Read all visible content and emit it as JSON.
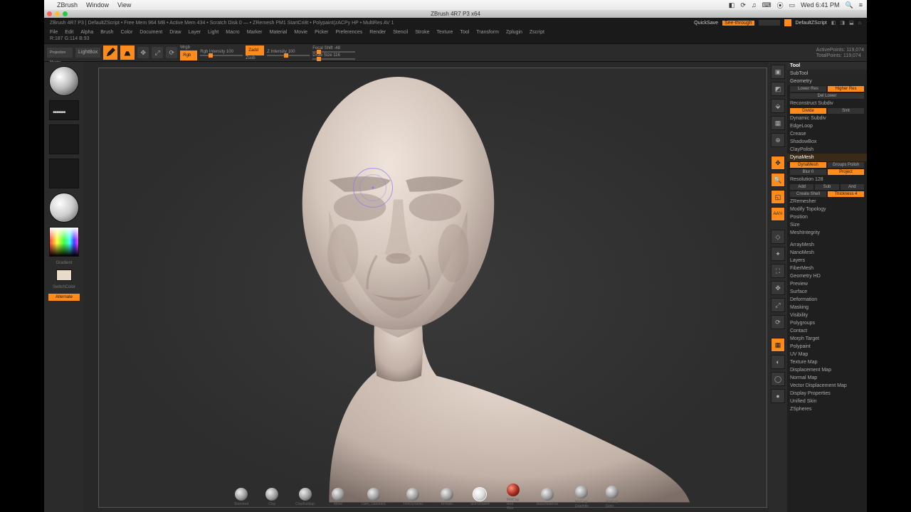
{
  "mac": {
    "app": "ZBrush",
    "menus": [
      "Window",
      "View"
    ],
    "clock": "Wed 6:41 PM"
  },
  "window": {
    "title": "ZBrush 4R7 P3 x64"
  },
  "topbar": {
    "project_info": "ZBrush 4R7 P3 | DefaultZScript  •  Free Mem 964 MB • Active Mem 434 • Scratch Disk 0  — • ZRemesh PM1 StartCri8t • Polypaint(zACPy HP • MultiRes AV 1",
    "quicksave": "QuickSave",
    "seethrough": "See-through",
    "script": "DefaultZScript"
  },
  "menu": [
    "File",
    "Edit",
    "Alpha",
    "Brush",
    "Color",
    "Document",
    "Draw",
    "Layer",
    "Light",
    "Macro",
    "Marker",
    "Material",
    "Movie",
    "Picker",
    "Preferences",
    "Render",
    "Stencil",
    "Stroke",
    "Texture",
    "Tool",
    "Transform",
    "Zplugin",
    "Zscript"
  ],
  "info_row": "R:187  G:114  B:93",
  "toolbar": {
    "projection": "Projection Master",
    "lightbox": "LightBox",
    "mrgb": "Mrgb",
    "rgb": "Rgb",
    "rgb_int": "Rgb Intensity 100",
    "zadd": "Zadd",
    "zsub": "Zsub",
    "z_int": "Z Intensity 100",
    "focal": "Focal Shift -48",
    "draw": "Draw Size 116",
    "active": "ActivePoints: 119,074",
    "total": "TotalPoints: 119,074"
  },
  "left": {
    "gradient": "Gradient",
    "switchcolor": "SwitchColor",
    "alternate": "Alternate"
  },
  "shelf": [
    "Standard",
    "Clay",
    "ClayBuildup",
    "Move",
    "Dam_Standard",
    "TrimDynamic",
    "hPolish",
    "SkinShade4",
    "MatCap Red Wax",
    "BasicMaterial",
    "MatCap Graphite",
    "MatCap Grey"
  ],
  "right_panel": {
    "tool": "Tool",
    "subtool": "SubTool",
    "geometry": "Geometry",
    "higher_res": "Higher Res",
    "lower_res": "Lower Res",
    "reconstruct": "Reconstruct Subdiv",
    "divide": "Divide",
    "del_lower": "Del Lower",
    "dynsmooth": "Smt",
    "edgeloop": "EdgeLoop",
    "crease": "Crease",
    "shadowbox": "ShadowBox",
    "claypolish": "ClayPolish",
    "dynamesh": "DynaMesh",
    "dyna_on": "DynaMesh",
    "groups_polish": "Groups Polish",
    "blur": "Blur 0",
    "project": "Project",
    "resolution": "Resolution 128",
    "add": "Add",
    "sub": "Sub",
    "and": "And",
    "create_shell": "Create Shell",
    "thickness": "Thickness 4",
    "zremesher": "ZRemesher",
    "modify_topo": "Modify Topology",
    "position": "Position",
    "size": "Size",
    "meshintegrity": "MeshIntegrity",
    "sections": [
      "ArrayMesh",
      "NanoMesh",
      "Layers",
      "FiberMesh",
      "Geometry HD",
      "Preview",
      "Surface",
      "Deformation",
      "Masking",
      "Visibility",
      "Polygroups",
      "Contact",
      "Morph Target",
      "Polypaint",
      "UV Map",
      "Texture Map",
      "Displacement Map",
      "Normal Map",
      "Vector Displacement Map",
      "Display Properties",
      "Unified Skin",
      "ZSpheres"
    ]
  }
}
